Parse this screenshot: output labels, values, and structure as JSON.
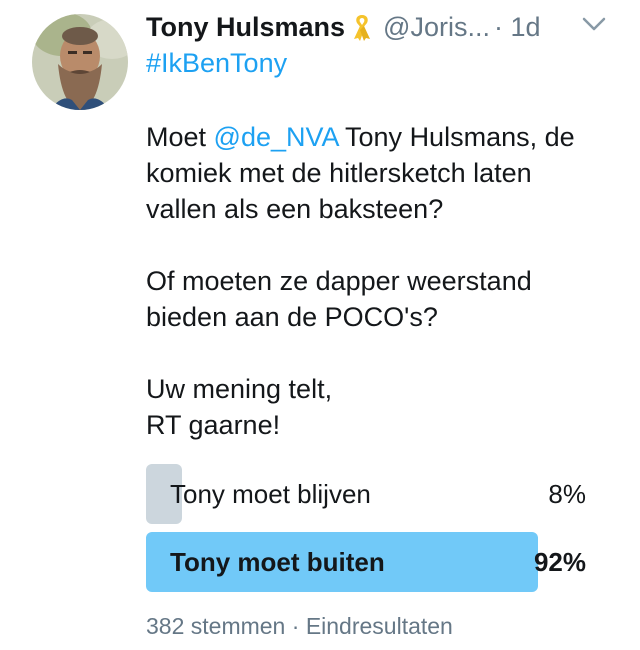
{
  "tweet": {
    "name": "Tony Hulsmans",
    "handle": "@Joris...",
    "time": "· 1d",
    "hashtag": "#IkBenTony",
    "body": {
      "p1_a": "Moet ",
      "p1_mention": "@de_NVA",
      "p1_b": " Tony Hulsmans, de",
      "p1_line2": "komiek met de hitlersketch laten",
      "p1_line3": "vallen als een baksteen?",
      "p2_line1": "Of moeten ze dapper weerstand",
      "p2_line2": "bieden aan de POCO's?",
      "p3_line1": "Uw mening telt,",
      "p3_line2": "RT gaarne!"
    }
  },
  "poll": {
    "options": [
      {
        "label": "Tony moet blijven",
        "percent_text": "8%",
        "percent": 8,
        "winner": false
      },
      {
        "label": "Tony moet buiten",
        "percent_text": "92%",
        "percent": 92,
        "winner": true
      }
    ],
    "votes": "382 stemmen",
    "separator": "·",
    "status": "Eindresultaten"
  },
  "icons": {
    "ribbon": "yellow-ribbon-icon",
    "caret": "chevron-down-icon"
  },
  "colors": {
    "link": "#1da1f2",
    "secondary_text": "#657786",
    "poll_winner": "#71c9f8",
    "poll_loser": "#ccd6dd",
    "ribbon": "#f5c32c"
  }
}
